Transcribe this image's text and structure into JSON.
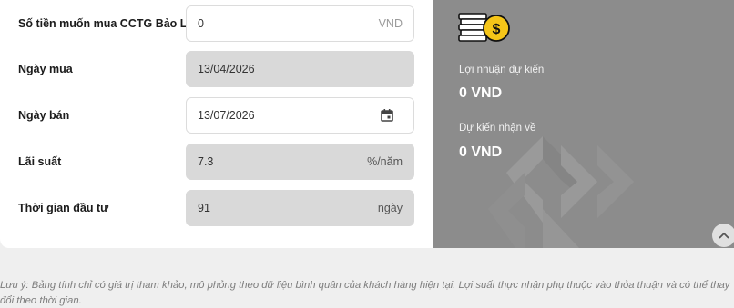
{
  "form": {
    "amount": {
      "label": "Số tiền muốn mua CCTG Bảo Lộc",
      "value": "0",
      "unit": "VND"
    },
    "buy_date": {
      "label": "Ngày mua",
      "value": "13/04/2026"
    },
    "sell_date": {
      "label": "Ngày bán",
      "value": "13/07/2026"
    },
    "interest": {
      "label": "Lãi suất",
      "value": "7.3",
      "unit": "%/năm"
    },
    "duration": {
      "label": "Thời gian đầu tư",
      "value": "91",
      "unit": "ngày"
    }
  },
  "result": {
    "profit_label": "Lợi nhuận dự kiến",
    "profit_value": "0 VND",
    "receive_label": "Dự kiến nhận về",
    "receive_value": "0 VND"
  },
  "note": "Lưu ý: Bảng tính chỉ có giá trị tham khảo, mô phỏng theo dữ liệu bình quân của khách hàng hiện tại. Lợi suất thực nhận phụ thuộc vào thỏa thuận và có thể thay đổi theo thời gian.",
  "colors": {
    "result_bg": "#8c8c8c",
    "coin_yellow": "#f5c518",
    "field_gray": "#d9d9d9"
  },
  "icons": [
    "coins-icon",
    "calendar-icon",
    "chevron-up-icon"
  ]
}
